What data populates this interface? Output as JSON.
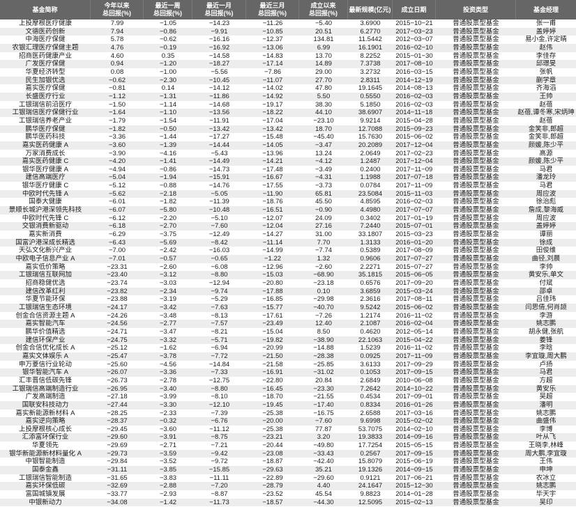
{
  "table": {
    "headers": [
      {
        "line1": "基金简称"
      },
      {
        "line1": "今年以来",
        "line2": "总回报(%)"
      },
      {
        "line1": "最近一周",
        "line2": "总回报(%)"
      },
      {
        "line1": "最近一月",
        "line2": "总回报(%)"
      },
      {
        "line1": "最近三月",
        "line2": "总回报(%)"
      },
      {
        "line1": "成立以来",
        "line2": "总回报(%)"
      },
      {
        "line1": "最新规模(亿元)"
      },
      {
        "line1": "成立日期"
      },
      {
        "line1": "投资类型"
      },
      {
        "line1": "基金经理"
      }
    ],
    "rows": [
      [
        "上投摩根医疗健康",
        "7.99",
        "−1.05",
        "−14.23",
        "−11.26",
        "−5.40",
        "3.6900",
        "2015−10−21",
        "普通股票型基金",
        "张一甫"
      ],
      [
        "文德医药创新",
        "7.94",
        "−0.86",
        "−9.91",
        "−10.85",
        "20.51",
        "6.2770",
        "2017−03−23",
        "普通股票型基金",
        "盖婷婷"
      ],
      [
        "中海医疗保健",
        "5.78",
        "−0.62",
        "−16.16",
        "−12.37",
        "134.81",
        "11.5442",
        "2012−03−07",
        "普通股票型基金",
        "易小金,许定晴"
      ],
      [
        "农银汇理医疗保健主题",
        "4.76",
        "−0.19",
        "−16.92",
        "−13.06",
        "6.99",
        "16.1901",
        "2016−02−10",
        "普通股票型基金",
        "赵伟"
      ],
      [
        "招商医药健康产业",
        "4.60",
        "0.35",
        "−14.58",
        "−14.83",
        "13.70",
        "8.2252",
        "2015−01−30",
        "普通股票型基金",
        "李佳存"
      ],
      [
        "广发医疗保健",
        "0.94",
        "−1.20",
        "−18.27",
        "−17.14",
        "14.89",
        "7.3738",
        "2017−08−10",
        "普通股票型基金",
        "邱璟旻"
      ],
      [
        "华夏经济转型",
        "0.08",
        "−1.00",
        "−5.56",
        "−7.86",
        "29.00",
        "3.2732",
        "2016−03−15",
        "普通股票型基金",
        "张帆"
      ],
      [
        "民生加银优选",
        "−0.62",
        "−2.30",
        "−10.45",
        "−11.07",
        "27.70",
        "2.8311",
        "2014−12−19",
        "普通股票型基金",
        "蒯学章"
      ],
      [
        "嘉实医疗保健",
        "−0.81",
        "0.14",
        "−14.12",
        "−14.02",
        "47.80",
        "19.1645",
        "2014−08−13",
        "普通股票型基金",
        "齐海滔"
      ],
      [
        "长盛医疗行业",
        "−1.12",
        "−1.31",
        "−11.86",
        "−14.92",
        "5.50",
        "0.5550",
        "2016−02−03",
        "普通股票型基金",
        "王帅"
      ],
      [
        "工银瑞信前沿医疗",
        "−1.50",
        "−1.14",
        "−14.68",
        "−19.17",
        "38.30",
        "5.1850",
        "2016−02−03",
        "普通股票型基金",
        "赵蓓"
      ],
      [
        "工银瑞信医疗保健行业",
        "−1.64",
        "−1.10",
        "−13.56",
        "−18.22",
        "44.10",
        "38.6907",
        "2014−11−18",
        "普通股票型基金",
        "赵蓓,谭冬寒,宋炳珅"
      ],
      [
        "工银瑞信养老产业",
        "−1.79",
        "−1.54",
        "−11.91",
        "−17.04",
        "−23.10",
        "9.9214",
        "2015−04−28",
        "普通股票型基金",
        "赵蓓"
      ],
      [
        "鹏华医疗保健",
        "−1.82",
        "−0.50",
        "−13.42",
        "−13.42",
        "18.70",
        "12.7088",
        "2015−09−23",
        "普通股票型基金",
        "金笑非,郎超"
      ],
      [
        "鹏华医药科技",
        "−3.36",
        "−1.44",
        "−17.27",
        "−15.48",
        "−45.40",
        "15.7630",
        "2015−06−02",
        "普通股票型基金",
        "金笑非,郎超"
      ],
      [
        "嘉实医药健康 A",
        "−3.60",
        "−1.39",
        "−14.44",
        "−14.05",
        "−3.47",
        "20.2089",
        "2017−12−04",
        "普通股票型基金",
        "颜媛,陈少平"
      ],
      [
        "万家消费成长",
        "−3.90",
        "−4.16",
        "−5.43",
        "−13.96",
        "13.24",
        "2.0649",
        "2017−02−23",
        "普通股票型基金",
        "高源"
      ],
      [
        "嘉实医药健康 C",
        "−4.20",
        "−1.41",
        "−14.49",
        "−14.21",
        "−4.12",
        "1.2487",
        "2017−12−04",
        "普通股票型基金",
        "颜媛,陈少平"
      ],
      [
        "银华医疗健康 A",
        "−4.94",
        "−0.86",
        "−14.73",
        "−17.48",
        "−3.49",
        "0.2400",
        "2017−11−09",
        "普通股票型基金",
        "马君"
      ],
      [
        "建信高端医疗",
        "−5.04",
        "−1.94",
        "−15.91",
        "−16.67",
        "−4.31",
        "1.1988",
        "2017−07−18",
        "普通股票型基金",
        "潘龙玲"
      ],
      [
        "银华医疗健康 C",
        "−5.12",
        "−0.88",
        "−14.76",
        "−17.55",
        "−3.73",
        "0.0784",
        "2017−11−09",
        "普通股票型基金",
        "马君"
      ],
      [
        "中欧时代先锋 A",
        "−5.62",
        "−2.18",
        "−5.05",
        "−11.90",
        "65.81",
        "23.5084",
        "2015−11−03",
        "普通股票型基金",
        "周应波"
      ],
      [
        "国泰大健康",
        "−6.01",
        "−1.82",
        "−11.39",
        "−18.76",
        "45.50",
        "4.8595",
        "2016−02−03",
        "普通股票型基金",
        "徐治彪"
      ],
      [
        "景顺长城沪港深领先科技",
        "−6.07",
        "−5.80",
        "−10.48",
        "−16.51",
        "−0.90",
        "4.4980",
        "2017−07−07",
        "普通股票型基金",
        "詹成,黎海威"
      ],
      [
        "中欧时代先锋 C",
        "−6.12",
        "−2.20",
        "−5.10",
        "−12.07",
        "24.09",
        "0.3402",
        "2017−01−19",
        "普通股票型基金",
        "周应波"
      ],
      [
        "交银消费新驱动",
        "−6.18",
        "−2.70",
        "−7.60",
        "−12.04",
        "27.16",
        "7.2440",
        "2015−07−01",
        "普通股票型基金",
        "盖婷婷"
      ],
      [
        "嘉实新消费",
        "−6.29",
        "−3.75",
        "−12.49",
        "−14.27",
        "31.00",
        "33.1807",
        "2015−03−23",
        "普通股票型基金",
        "谭丽"
      ],
      [
        "国富沪港深成长精选",
        "−6.43",
        "−5.69",
        "−8.42",
        "−11.14",
        "7.70",
        "1.3133",
        "2016−01−20",
        "普通股票型基金",
        "徐成"
      ],
      [
        "天弘文化新兴产业",
        "−7.00",
        "−2.42",
        "−16.03",
        "−14.99",
        "−7.74",
        "0.5389",
        "2017−08−09",
        "普通股票型基金",
        "田俊维"
      ],
      [
        "中欧电子信息产业 A",
        "−7.01",
        "−0.57",
        "−0.65",
        "−1.22",
        "1.32",
        "0.9606",
        "2017−07−27",
        "普通股票型基金",
        "曲径,刘晨"
      ],
      [
        "嘉实低价策略",
        "−23.31",
        "−2.60",
        "−6.08",
        "−12.96",
        "−2.60",
        "2.2271",
        "2015−07−27",
        "普通股票型基金",
        "李帅"
      ],
      [
        "工银瑞信互联网加",
        "−23.40",
        "−3.12",
        "−8.80",
        "−15.03",
        "−68.90",
        "35.1815",
        "2015−06−05",
        "普通股票型基金",
        "黄安乐,单文"
      ],
      [
        "招商稳健优选",
        "−23.74",
        "−3.03",
        "−12.94",
        "−20.80",
        "−23.18",
        "0.6576",
        "2017−09−20",
        "普通股票型基金",
        "付斌"
      ],
      [
        "建信改革红利",
        "−23.82",
        "−2.34",
        "−9.74",
        "−17.88",
        "0.10",
        "3.6859",
        "2015−03−24",
        "普通股票型基金",
        "邵卓"
      ],
      [
        "华夏节能环保",
        "−23.88",
        "−3.19",
        "−5.29",
        "−16.85",
        "−29.98",
        "2.3616",
        "2017−08−11",
        "普通股票型基金",
        "吕佳玮"
      ],
      [
        "工银瑞信生态环境",
        "−24.17",
        "−3.42",
        "−7.63",
        "−15.77",
        "−40.70",
        "9.5242",
        "2015−06−02",
        "普通股票型基金",
        "闫思倩,何肖颉"
      ],
      [
        "创金合信资源主题 A",
        "−24.26",
        "−3.48",
        "−8.13",
        "−17.61",
        "−7.26",
        "1.2174",
        "2016−11−02",
        "普通股票型基金",
        "李游"
      ],
      [
        "嘉实智能汽车",
        "−24.56",
        "−2.77",
        "−7.57",
        "−23.49",
        "12.40",
        "2.1087",
        "2016−02−04",
        "普通股票型基金",
        "姚志鹏"
      ],
      [
        "鹏华价值精选",
        "−24.71",
        "−3.47",
        "−8.21",
        "−15.04",
        "8.50",
        "0.4620",
        "2012−05−14",
        "普通股票型基金",
        "胡永健,张航"
      ],
      [
        "建信环保产业",
        "−24.75",
        "−3.32",
        "−5.71",
        "−19.82",
        "−38.90",
        "22.1063",
        "2015−04−22",
        "普通股票型基金",
        "姜锋"
      ],
      [
        "创金合信优化成长 A",
        "−25.12",
        "−1.62",
        "−6.94",
        "−20.99",
        "−14.88",
        "1.5239",
        "2016−11−02",
        "普通股票型基金",
        "李晗"
      ],
      [
        "嘉实文体娱乐 A",
        "−25.47",
        "−3.78",
        "−7.72",
        "−21.50",
        "−28.38",
        "0.0925",
        "2017−11−09",
        "普通股票型基金",
        "李宜璇,周大鹏"
      ],
      [
        "申万菱信行业轮动",
        "−25.60",
        "−4.56",
        "−14.84",
        "−21.58",
        "−25.85",
        "3.6133",
        "2017−09−29",
        "普通股票型基金",
        "卢扬"
      ],
      [
        "银华智能汽车 A",
        "−26.07",
        "−3.36",
        "−7.33",
        "−16.91",
        "−31.02",
        "0.1053",
        "2017−09−15",
        "普通股票型基金",
        "马君"
      ],
      [
        "汇丰晋信低碳先锋",
        "−26.73",
        "−2.78",
        "−12.75",
        "−22.80",
        "20.84",
        "2.6849",
        "2010−06−08",
        "普通股票型基金",
        "方超"
      ],
      [
        "工银瑞信高端制造行业",
        "−26.95",
        "−3.40",
        "−8.80",
        "−16.45",
        "−23.30",
        "7.2642",
        "2014−10−22",
        "普通股票型基金",
        "黄安乐"
      ],
      [
        "广发高端制造",
        "−27.18",
        "−3.99",
        "−8.10",
        "−18.70",
        "−21.55",
        "0.4534",
        "2017−09−01",
        "普通股票型基金",
        "吴超"
      ],
      [
        "国联安科技动力",
        "−27.44",
        "−3.30",
        "−12.10",
        "−19.45",
        "−17.40",
        "0.8334",
        "2016−01−26",
        "普通股票型基金",
        "潘明"
      ],
      [
        "嘉实新能源新材料 A",
        "−28.25",
        "−2.33",
        "−7.39",
        "−25.38",
        "−16.75",
        "2.6588",
        "2017−03−16",
        "普通股票型基金",
        "姚志鹏"
      ],
      [
        "嘉实逆向策略",
        "−28.37",
        "−0.32",
        "−6.76",
        "−20.00",
        "−7.60",
        "9.6998",
        "2015−02−02",
        "普通股票型基金",
        "曲盛伟"
      ],
      [
        "上投摩根核心成长",
        "−29.45",
        "−3.60",
        "−11.12",
        "−25.38",
        "77.87",
        "53.7075",
        "2014−02−10",
        "普通股票型基金",
        "李博"
      ],
      [
        "汇添富环保行业",
        "−29.60",
        "−3.91",
        "−8.75",
        "−23.21",
        "3.20",
        "19.3833",
        "2014−09−16",
        "普通股票型基金",
        "叶从飞"
      ],
      [
        "华夏领先",
        "−29.69",
        "−2.71",
        "−7.21",
        "−20.44",
        "−49.80",
        "17.7254",
        "2015−05−15",
        "普通股票型基金",
        "王晓李,林峰"
      ],
      [
        "银华新能源新材料量化 A",
        "−29.73",
        "−3.59",
        "−9.42",
        "−23.08",
        "−33.43",
        "0.2567",
        "2017−09−15",
        "普通股票型基金",
        "周大鹏,李宜璇"
      ],
      [
        "中银智能制造",
        "−29.84",
        "−3.52",
        "−9.72",
        "−18.87",
        "−42.40",
        "15.8079",
        "2015−06−19",
        "普通股票型基金",
        "王伟"
      ],
      [
        "国泰金鑫",
        "−31.11",
        "−3.85",
        "−15.85",
        "−29.63",
        "35.21",
        "19.1326",
        "2014−09−15",
        "普通股票型基金",
        "申坤"
      ],
      [
        "工银瑞信智能制造",
        "−31.65",
        "−3.83",
        "−11.11",
        "−22.89",
        "−29.60",
        "0.9121",
        "2017−06−21",
        "普通股票型基金",
        "农冰立"
      ],
      [
        "嘉实环保低碳",
        "−32.69",
        "−2.88",
        "−7.20",
        "−28.79",
        "4.40",
        "24.1647",
        "2015−12−30",
        "普通股票型基金",
        "姚志鹏"
      ],
      [
        "富国城镇发展",
        "−33.77",
        "−2.93",
        "−8.87",
        "−23.52",
        "45.54",
        "9.8823",
        "2014−01−28",
        "普通股票型基金",
        "毕天宇"
      ],
      [
        "中银新动力",
        "−34.08",
        "−1.42",
        "−11.73",
        "−18.57",
        "−44.30",
        "12.5095",
        "2015−02−13",
        "普通股票型基金",
        "吴印"
      ]
    ]
  }
}
